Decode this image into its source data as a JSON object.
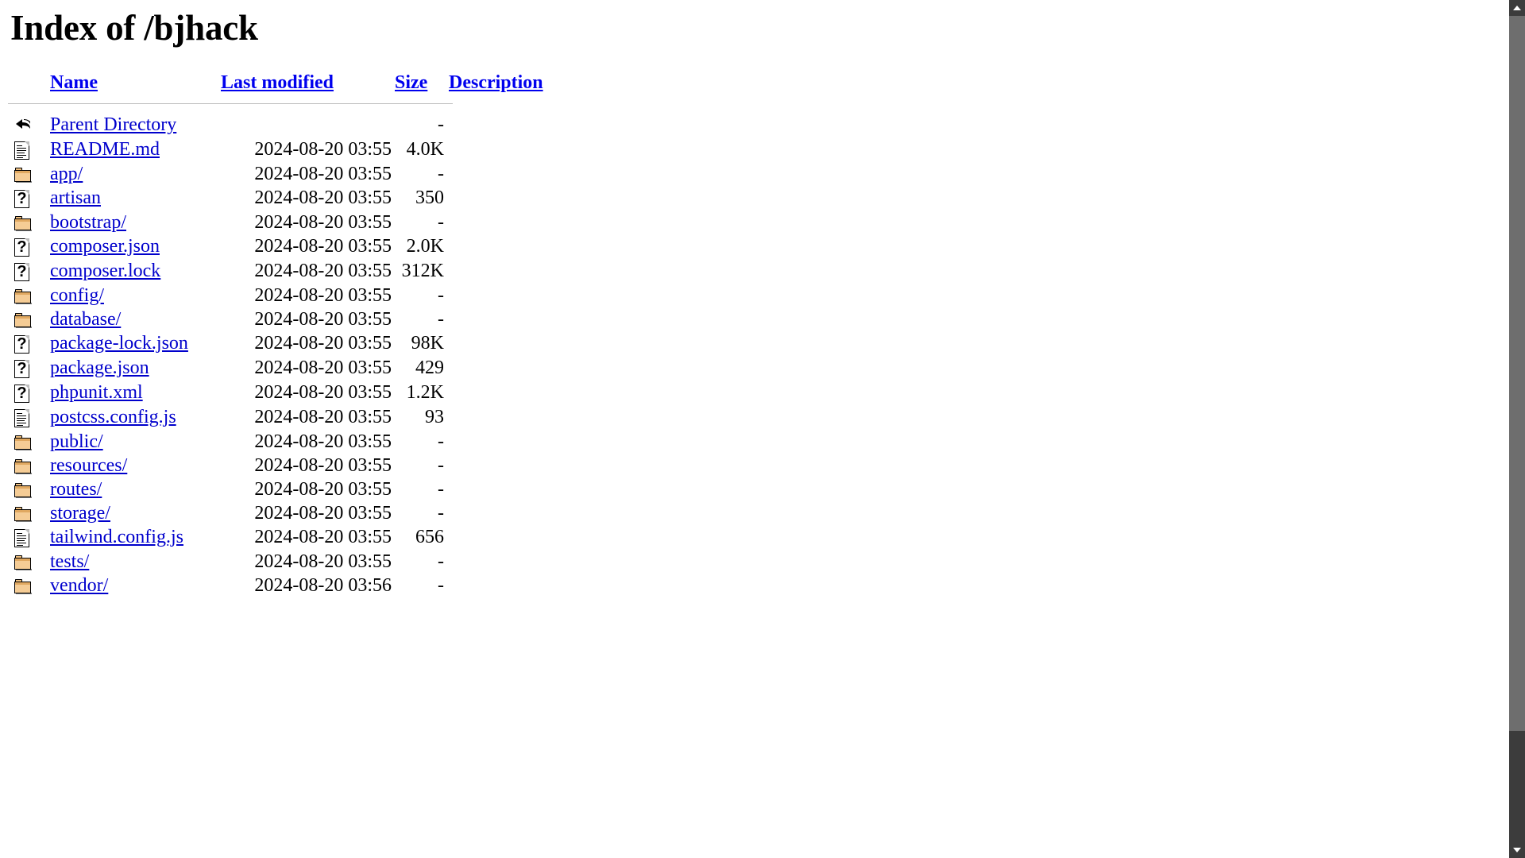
{
  "page": {
    "title": "Index of /bjhack",
    "document_title": "Index of /bjhack"
  },
  "table": {
    "headers": {
      "icon": "",
      "name": "Name",
      "last_modified": "Last modified",
      "size": "Size",
      "description": "Description"
    },
    "rows": [
      {
        "icon": "back-icon",
        "name": "Parent Directory",
        "last_modified": "",
        "size": "-",
        "description": ""
      },
      {
        "icon": "text-icon",
        "name": "README.md",
        "last_modified": "2024-08-20 03:55",
        "size": "4.0K",
        "description": ""
      },
      {
        "icon": "folder-icon",
        "name": "app/",
        "last_modified": "2024-08-20 03:55",
        "size": "-",
        "description": ""
      },
      {
        "icon": "unknown-icon",
        "name": "artisan",
        "last_modified": "2024-08-20 03:55",
        "size": "350",
        "description": ""
      },
      {
        "icon": "folder-icon",
        "name": "bootstrap/",
        "last_modified": "2024-08-20 03:55",
        "size": "-",
        "description": ""
      },
      {
        "icon": "unknown-icon",
        "name": "composer.json",
        "last_modified": "2024-08-20 03:55",
        "size": "2.0K",
        "description": ""
      },
      {
        "icon": "unknown-icon",
        "name": "composer.lock",
        "last_modified": "2024-08-20 03:55",
        "size": "312K",
        "description": ""
      },
      {
        "icon": "folder-icon",
        "name": "config/",
        "last_modified": "2024-08-20 03:55",
        "size": "-",
        "description": ""
      },
      {
        "icon": "folder-icon",
        "name": "database/",
        "last_modified": "2024-08-20 03:55",
        "size": "-",
        "description": ""
      },
      {
        "icon": "unknown-icon",
        "name": "package-lock.json",
        "last_modified": "2024-08-20 03:55",
        "size": "98K",
        "description": ""
      },
      {
        "icon": "unknown-icon",
        "name": "package.json",
        "last_modified": "2024-08-20 03:55",
        "size": "429",
        "description": ""
      },
      {
        "icon": "unknown-icon",
        "name": "phpunit.xml",
        "last_modified": "2024-08-20 03:55",
        "size": "1.2K",
        "description": ""
      },
      {
        "icon": "text-icon",
        "name": "postcss.config.js",
        "last_modified": "2024-08-20 03:55",
        "size": "93",
        "description": ""
      },
      {
        "icon": "folder-icon",
        "name": "public/",
        "last_modified": "2024-08-20 03:55",
        "size": "-",
        "description": ""
      },
      {
        "icon": "folder-icon",
        "name": "resources/",
        "last_modified": "2024-08-20 03:55",
        "size": "-",
        "description": ""
      },
      {
        "icon": "folder-icon",
        "name": "routes/",
        "last_modified": "2024-08-20 03:55",
        "size": "-",
        "description": ""
      },
      {
        "icon": "folder-icon",
        "name": "storage/",
        "last_modified": "2024-08-20 03:55",
        "size": "-",
        "description": ""
      },
      {
        "icon": "text-icon",
        "name": "tailwind.config.js",
        "last_modified": "2024-08-20 03:55",
        "size": "656",
        "description": ""
      },
      {
        "icon": "folder-icon",
        "name": "tests/",
        "last_modified": "2024-08-20 03:55",
        "size": "-",
        "description": ""
      },
      {
        "icon": "folder-icon",
        "name": "vendor/",
        "last_modified": "2024-08-20 03:56",
        "size": "-",
        "description": ""
      }
    ]
  },
  "scrollbar": {
    "up_arrow": "scroll-up-arrow",
    "down_arrow": "scroll-down-arrow",
    "thumb": "scroll-thumb"
  },
  "colors": {
    "link": "#0000cc",
    "header_link": "#0000ee",
    "rule": "#bdbdbd",
    "folder": "#f5cc95",
    "scrollbar_track": "#3c3c3c",
    "scrollbar_thumb": "#6e6e6e"
  }
}
